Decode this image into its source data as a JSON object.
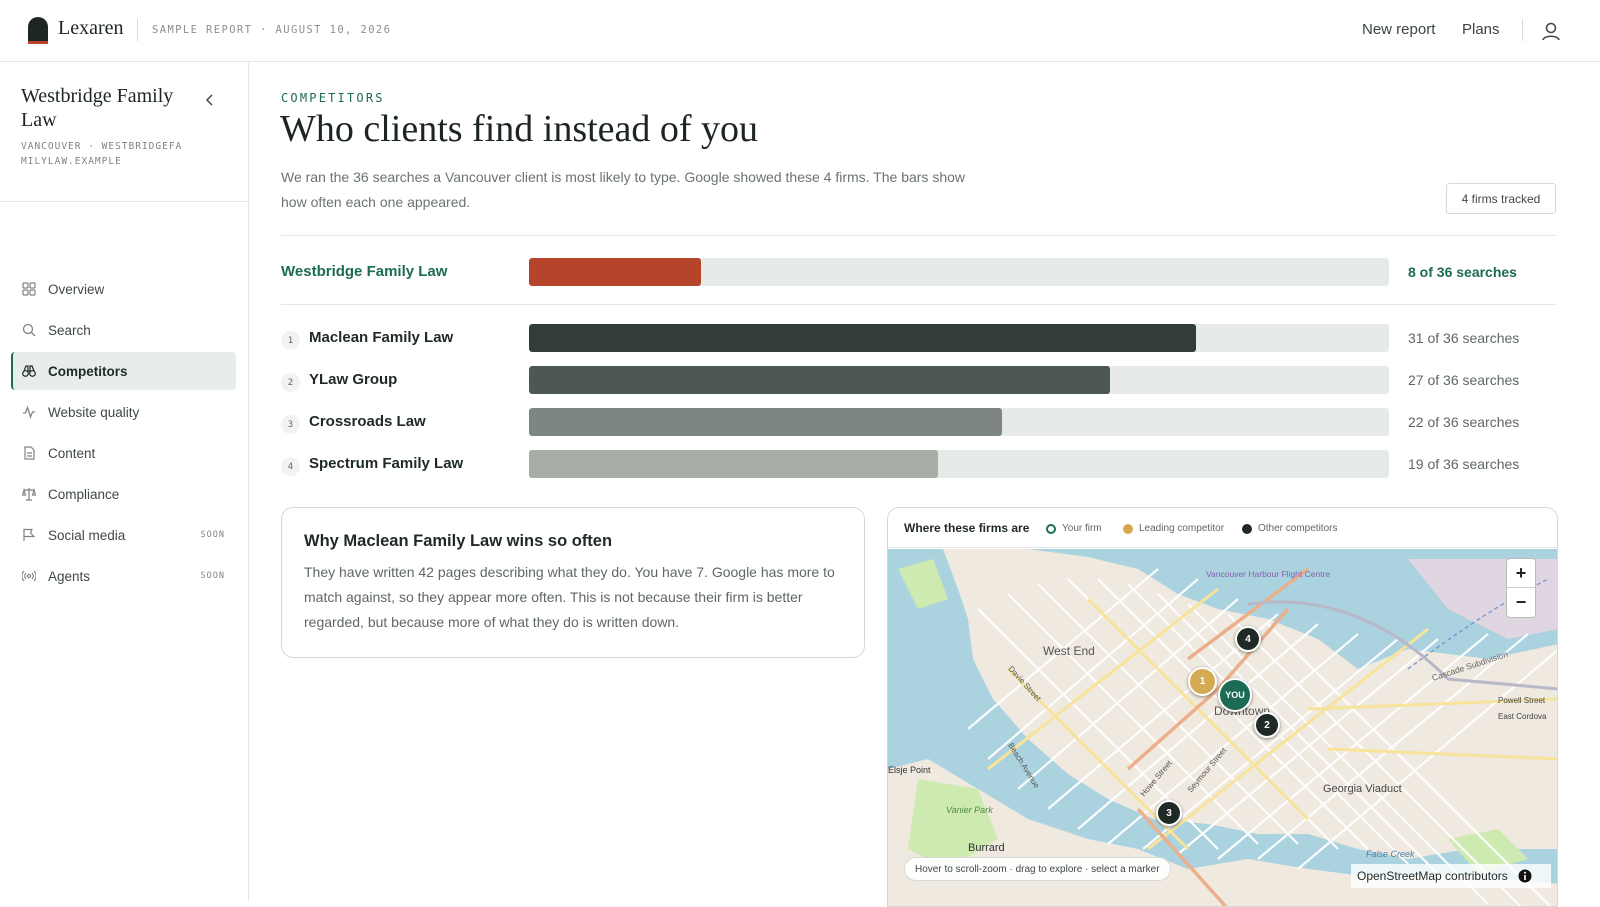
{
  "app": {
    "brand": "Lexaren",
    "report_tag": "SAMPLE REPORT · AUGUST 10, 2026",
    "nav": {
      "new_report": "New report",
      "plans": "Plans"
    }
  },
  "sidebar": {
    "firm_name": "Westbridge Family Law",
    "firm_meta": "VANCOUVER · WESTBRIDGEFAMILYLAW.EXAMPLE",
    "items": [
      {
        "label": "Overview",
        "icon": "grid-icon"
      },
      {
        "label": "Search",
        "icon": "search-icon"
      },
      {
        "label": "Competitors",
        "icon": "binoculars-icon",
        "active": true
      },
      {
        "label": "Website quality",
        "icon": "pulse-icon"
      },
      {
        "label": "Content",
        "icon": "document-icon"
      },
      {
        "label": "Compliance",
        "icon": "scales-icon"
      },
      {
        "label": "Social media",
        "icon": "flag-icon",
        "badge": "SOON"
      },
      {
        "label": "Agents",
        "icon": "broadcast-icon",
        "badge": "SOON"
      }
    ]
  },
  "main": {
    "eyebrow": "COMPETITORS",
    "title": "Who clients find instead of you",
    "intro": "We ran the 36 searches a Vancouver client is most likely to type. Google showed these 4 firms. The bars show how often each one appeared.",
    "tracked_badge": "4 firms tracked",
    "your_firm": {
      "name": "Westbridge Family Law",
      "count": 8,
      "total": 36,
      "count_text": "8 of 36 searches",
      "color": "#b5442a"
    },
    "competitors": [
      {
        "rank": "1",
        "name": "Maclean Family Law",
        "count": 31,
        "total": 36,
        "count_text": "31 of 36 searches",
        "color": "#333c37"
      },
      {
        "rank": "2",
        "name": "YLaw Group",
        "count": 27,
        "total": 36,
        "count_text": "27 of 36 searches",
        "color": "#4e5852"
      },
      {
        "rank": "3",
        "name": "Crossroads Law",
        "count": 22,
        "total": 36,
        "count_text": "22 of 36 searches",
        "color": "#7d8680"
      },
      {
        "rank": "4",
        "name": "Spectrum Family Law",
        "count": 19,
        "total": 36,
        "count_text": "19 of 36 searches",
        "color": "#a7aea8"
      }
    ],
    "why_card": {
      "title": "Why Maclean Family Law wins so often",
      "body": "They have written 42 pages describing what they do. You have 7. Google has more to match against, so they appear more often. This is not because their firm is better regarded, but because more of what they do is written down."
    },
    "map": {
      "title": "Where these firms are",
      "legend": [
        {
          "label": "Your firm",
          "color": "#1c6b55"
        },
        {
          "label": "Leading competitor",
          "color": "#d4aa52"
        },
        {
          "label": "Other competitors",
          "color": "#1f2a26"
        }
      ],
      "labels": {
        "west_end": "West End",
        "downtown": "Downtown",
        "airport": "Vancouver Harbour Flight Centre",
        "davie": "Davie Street",
        "beach": "Beach Avenue",
        "howe": "Howe Street",
        "seymour": "Seymour Street",
        "cascade": "Cascade Subdivision",
        "powell": "Powell Street",
        "east_cordova": "East Cordova",
        "georgia": "Georgia Viaduct",
        "false_creek": "False Creek",
        "burrard": "Burrard",
        "vanier": "Vanier Park",
        "elsje": "Elsje Point"
      },
      "markers": {
        "you": "YOU",
        "m1": "1",
        "m2": "2",
        "m3": "3",
        "m4": "4"
      },
      "zoom_in": "+",
      "zoom_out": "−",
      "hint": "Hover to scroll-zoom · drag to explore · select a marker",
      "attribution": "OpenStreetMap contributors"
    }
  }
}
